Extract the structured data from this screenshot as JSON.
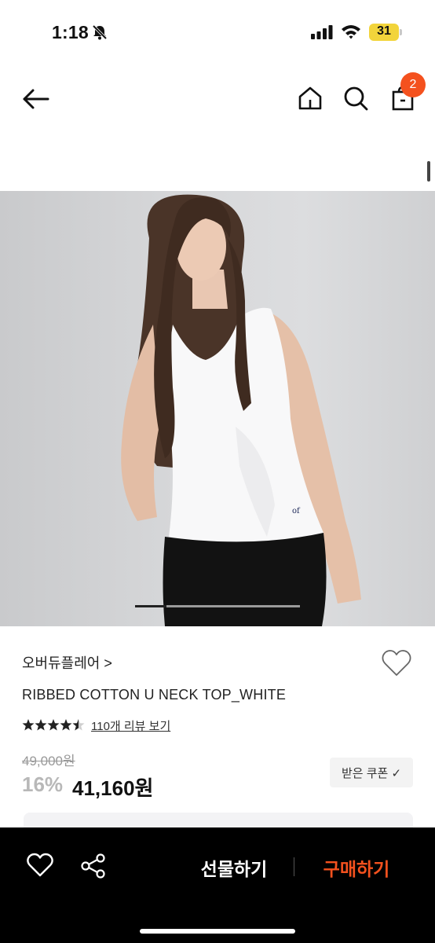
{
  "status_bar": {
    "time": "1:18",
    "battery": "31",
    "icons": [
      "bell-muted-icon",
      "signal-icon",
      "wifi-icon",
      "battery-icon"
    ],
    "battery_color": "#f2d43b"
  },
  "nav": {
    "icons": [
      "back-arrow-icon",
      "home-icon",
      "search-icon",
      "shopping-bag-icon"
    ],
    "cart_count": "2",
    "badge_color": "#f4511e"
  },
  "product": {
    "brand": "오버듀플레어 >",
    "title": "RIBBED COTTON U NECK TOP_WHITE",
    "rating_stars": 4.5,
    "review_link": "110개 리뷰 보기",
    "original_price": "49,000원",
    "discount": "16%",
    "price": "41,160원",
    "coupon_label": "받은 쿠폰 ✓",
    "image_index": 1,
    "image_count": 5
  },
  "bottom_bar": {
    "gift_label": "선물하기",
    "buy_label": "구매하기",
    "accent_color": "#f4511e",
    "icons": [
      "heart-outline-icon",
      "share-icon"
    ]
  }
}
